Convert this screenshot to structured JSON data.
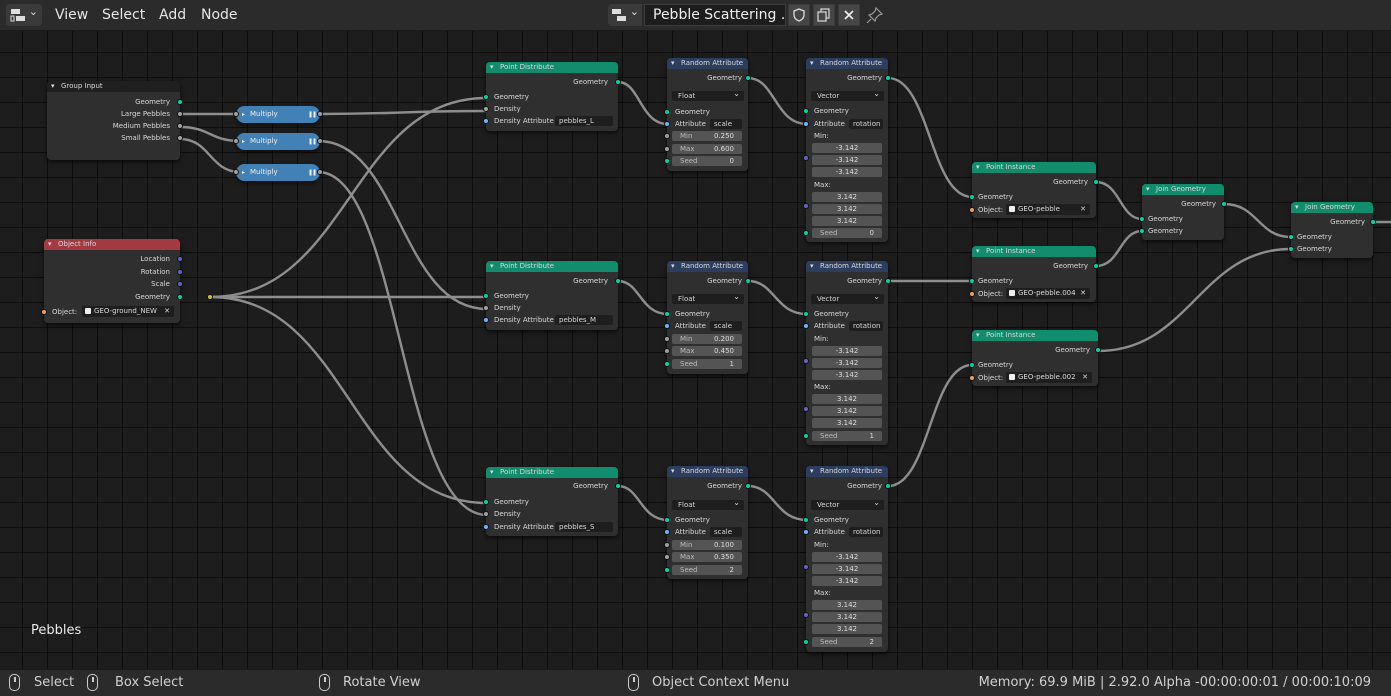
{
  "header": {
    "menus": [
      "View",
      "Select",
      "Add",
      "Node"
    ],
    "node_tree_name": "Pebble Scattering ..."
  },
  "frame": {
    "label": "Pebbles"
  },
  "colors": {
    "geometry_header": "#118c6c",
    "attribute_header": "#2d3d5e",
    "object_header": "#a33a42",
    "math_node": "#4281b5",
    "geometry_socket": "#00d6a3",
    "vector_socket": "#6363c7",
    "float_socket": "#a1a1a1",
    "object_socket": "#ed9e5c",
    "string_socket": "#70b2ff"
  },
  "nodes": {
    "group_input": {
      "title": "Group Input",
      "outputs": [
        "Geometry",
        "Large Pebbles",
        "Medium Pebbles",
        "Small Pebbles"
      ]
    },
    "object_info": {
      "title": "Object Info",
      "outputs": [
        "Location",
        "Rotation",
        "Scale",
        "Geometry"
      ],
      "object_label": "Object:",
      "object_value": "GEO-ground_NEW"
    },
    "multiply": {
      "label": "Multiply"
    },
    "point_distribute": {
      "title": "Point Distribute",
      "output": "Geometry",
      "inputs": [
        "Geometry",
        "Density",
        "Density Attribute"
      ],
      "attrs": [
        "pebbles_L",
        "pebbles_M",
        "pebbles_S"
      ]
    },
    "random_attr_float": {
      "title": "Random Attribute",
      "output": "Geometry",
      "type": "Float",
      "geometry": "Geometry",
      "attribute_label": "Attribute",
      "attribute": "scale",
      "min_label": "Min",
      "max_label": "Max",
      "seed_label": "Seed",
      "items": [
        {
          "min": "0.250",
          "max": "0.600",
          "seed": "0"
        },
        {
          "min": "0.200",
          "max": "0.450",
          "seed": "1"
        },
        {
          "min": "0.100",
          "max": "0.350",
          "seed": "2"
        }
      ]
    },
    "random_attr_vector": {
      "title": "Random Attribute",
      "output": "Geometry",
      "type": "Vector",
      "geometry": "Geometry",
      "attribute_label": "Attribute",
      "attribute": "rotation",
      "min_label": "Min:",
      "max_label": "Max:",
      "seed_label": "Seed",
      "min": [
        "-3.142",
        "-3.142",
        "-3.142"
      ],
      "max": [
        "3.142",
        "3.142",
        "3.142"
      ],
      "seeds": [
        "0",
        "1",
        "2"
      ]
    },
    "point_instance": {
      "title": "Point Instance",
      "output": "Geometry",
      "input": "Geometry",
      "object_label": "Object:",
      "objects": [
        "GEO-pebble",
        "GEO-pebble.004",
        "GEO-pebble.002"
      ]
    },
    "join_geometry": {
      "title": "Join Geometry",
      "output": "Geometry",
      "inputs": [
        "Geometry",
        "Geometry"
      ]
    }
  },
  "status": {
    "select": "Select",
    "box_select": "Box Select",
    "rotate_view": "Rotate View",
    "context_menu": "Object Context Menu",
    "stats": "Memory: 69.9 MiB | 2.92.0 Alpha  -00:00:00:01 / 00:00:10:09"
  }
}
